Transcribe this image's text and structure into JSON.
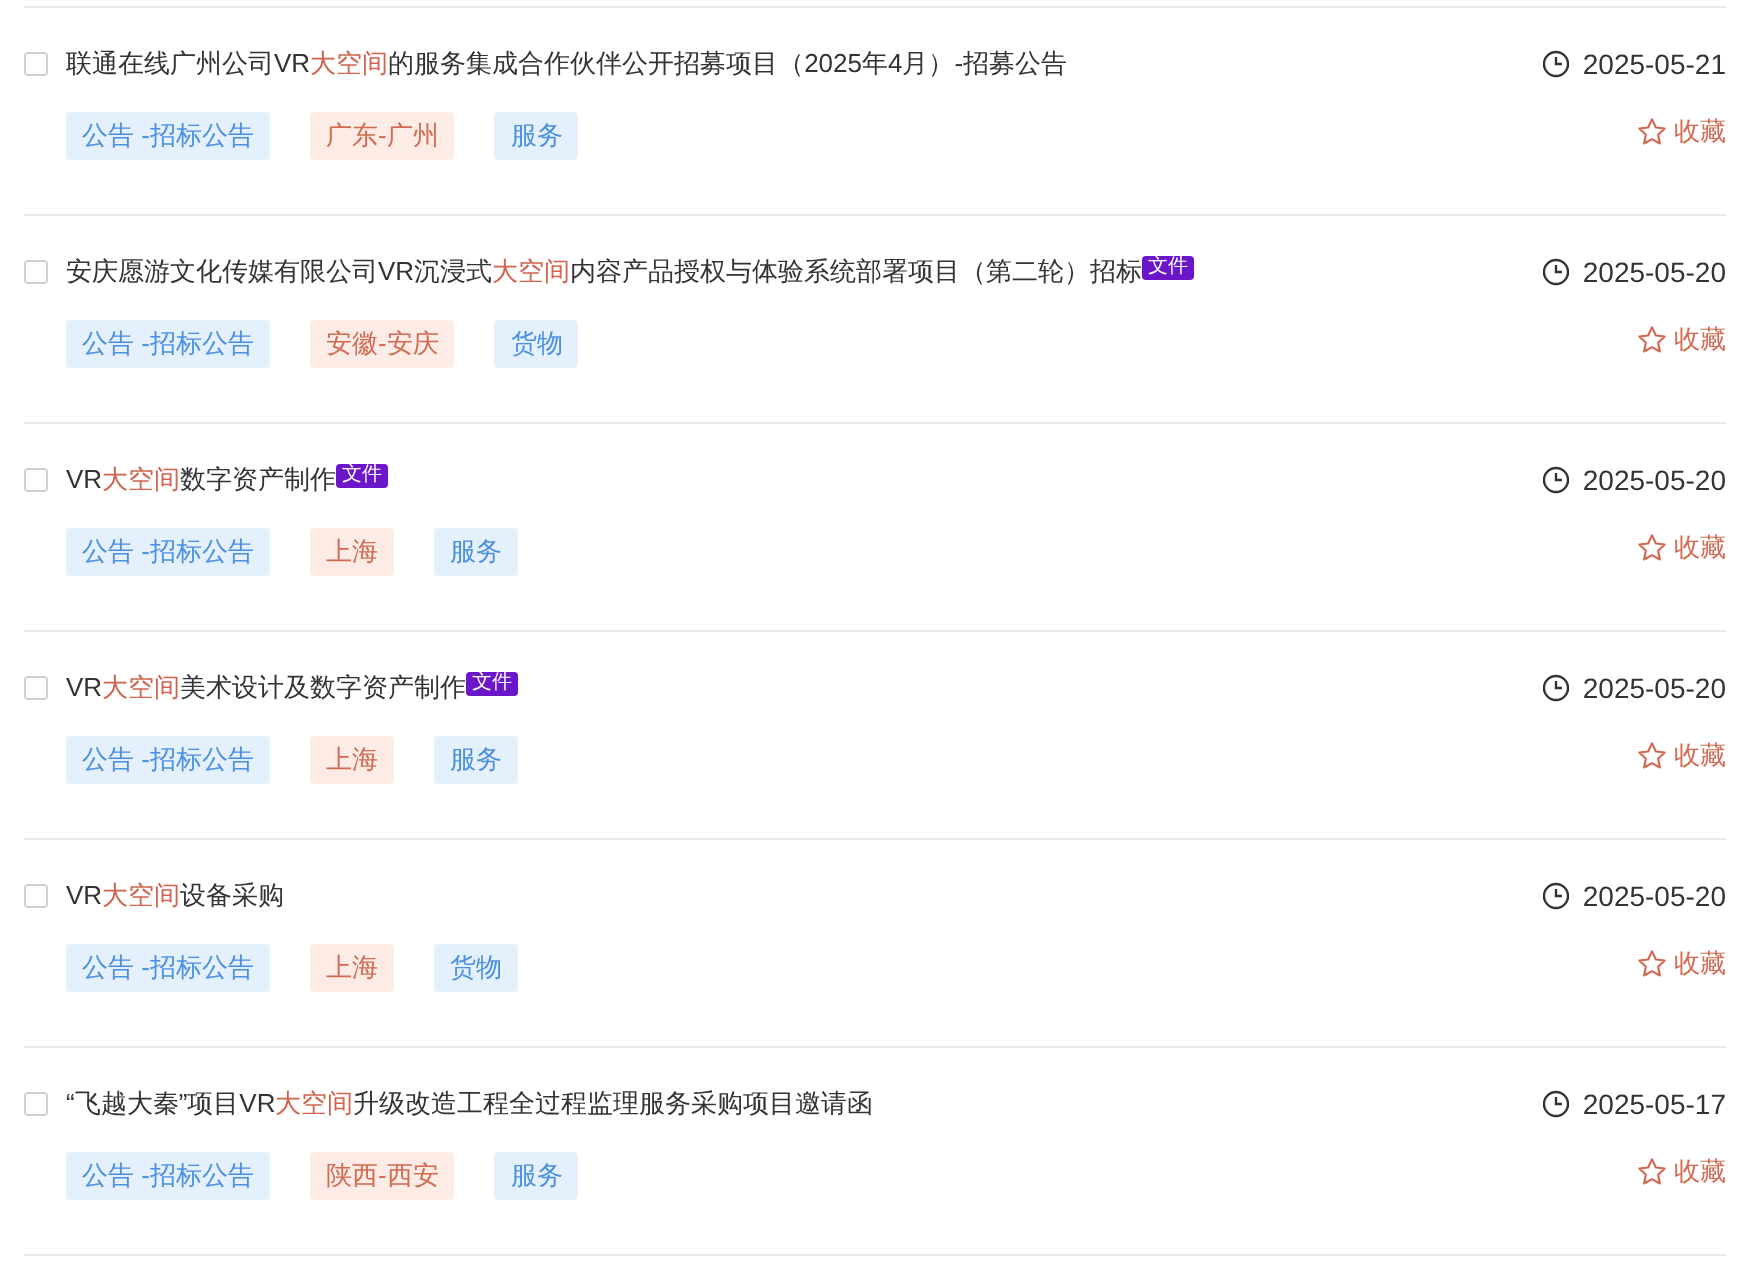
{
  "items": [
    {
      "checked": false,
      "title": [
        {
          "text": "联通在线广州公司VR",
          "highlight": false
        },
        {
          "text": "大空间",
          "highlight": true
        },
        {
          "text": "的服务集成合作伙伴公开招募项目（2025年4月）-招募公告",
          "highlight": false
        }
      ],
      "date": "2025-05-21",
      "tags": [
        {
          "text": "公告 -招标公告",
          "kind": "type"
        },
        {
          "text": "广东-广州",
          "kind": "region"
        },
        {
          "text": "服务",
          "kind": "category"
        }
      ],
      "favorite": "收藏"
    },
    {
      "checked": false,
      "title": [
        {
          "text": "安庆愿游文化传媒有限公司VR沉浸式",
          "highlight": false
        },
        {
          "text": "大空间",
          "highlight": true
        },
        {
          "text": "内容产品授权与体验系统部署项目（第二轮）招标",
          "highlight": false
        }
      ],
      "file_badge": "文件",
      "date": "2025-05-20",
      "tags": [
        {
          "text": "公告 -招标公告",
          "kind": "type"
        },
        {
          "text": "安徽-安庆",
          "kind": "region"
        },
        {
          "text": "货物",
          "kind": "category"
        }
      ],
      "favorite": "收藏"
    },
    {
      "checked": false,
      "title": [
        {
          "text": "VR",
          "highlight": false
        },
        {
          "text": "大空间",
          "highlight": true
        },
        {
          "text": "数字资产制作",
          "highlight": false
        }
      ],
      "file_badge": "文件",
      "date": "2025-05-20",
      "tags": [
        {
          "text": "公告 -招标公告",
          "kind": "type"
        },
        {
          "text": "上海",
          "kind": "region"
        },
        {
          "text": "服务",
          "kind": "category"
        }
      ],
      "favorite": "收藏"
    },
    {
      "checked": false,
      "title": [
        {
          "text": "VR",
          "highlight": false
        },
        {
          "text": "大空间",
          "highlight": true
        },
        {
          "text": "美术设计及数字资产制作",
          "highlight": false
        }
      ],
      "file_badge": "文件",
      "date": "2025-05-20",
      "tags": [
        {
          "text": "公告 -招标公告",
          "kind": "type"
        },
        {
          "text": "上海",
          "kind": "region"
        },
        {
          "text": "服务",
          "kind": "category"
        }
      ],
      "favorite": "收藏"
    },
    {
      "checked": false,
      "title": [
        {
          "text": "VR",
          "highlight": false
        },
        {
          "text": "大空间",
          "highlight": true
        },
        {
          "text": "设备采购",
          "highlight": false
        }
      ],
      "date": "2025-05-20",
      "tags": [
        {
          "text": "公告 -招标公告",
          "kind": "type"
        },
        {
          "text": "上海",
          "kind": "region"
        },
        {
          "text": "货物",
          "kind": "category"
        }
      ],
      "favorite": "收藏"
    },
    {
      "checked": false,
      "title": [
        {
          "text": "“飞越大秦”项目VR",
          "highlight": false
        },
        {
          "text": "大空间",
          "highlight": true
        },
        {
          "text": "升级改造工程全过程监理服务采购项目邀请函",
          "highlight": false
        }
      ],
      "date": "2025-05-17",
      "tags": [
        {
          "text": "公告 -招标公告",
          "kind": "type"
        },
        {
          "text": "陕西-西安",
          "kind": "region"
        },
        {
          "text": "服务",
          "kind": "category"
        }
      ],
      "favorite": "收藏"
    }
  ]
}
